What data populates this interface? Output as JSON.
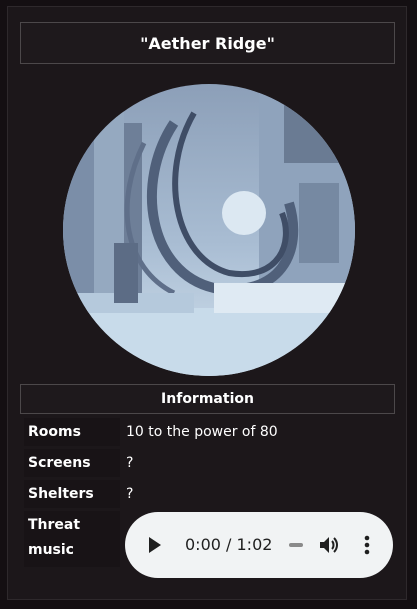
{
  "infobox": {
    "title": "\"Aether Ridge\"",
    "image_alt_icon": "region-art-image",
    "section_header": "Information",
    "rows": [
      {
        "label": "Rooms",
        "value": "10 to the power of 80"
      },
      {
        "label": "Screens",
        "value": "?"
      },
      {
        "label": "Shelters",
        "value": "?"
      },
      {
        "label": "Threat music",
        "value": ""
      }
    ]
  },
  "audio_player": {
    "time_display": "0:00 / 1:02",
    "current_time": "0:00",
    "duration": "1:02",
    "progress": 0,
    "icons": [
      "play-icon",
      "volume-icon",
      "more-options-icon"
    ]
  },
  "colors": {
    "page_background": "#140f12",
    "panel_background": "#1c171a",
    "border": "#4c484a",
    "player_background": "#f1f3f4"
  }
}
